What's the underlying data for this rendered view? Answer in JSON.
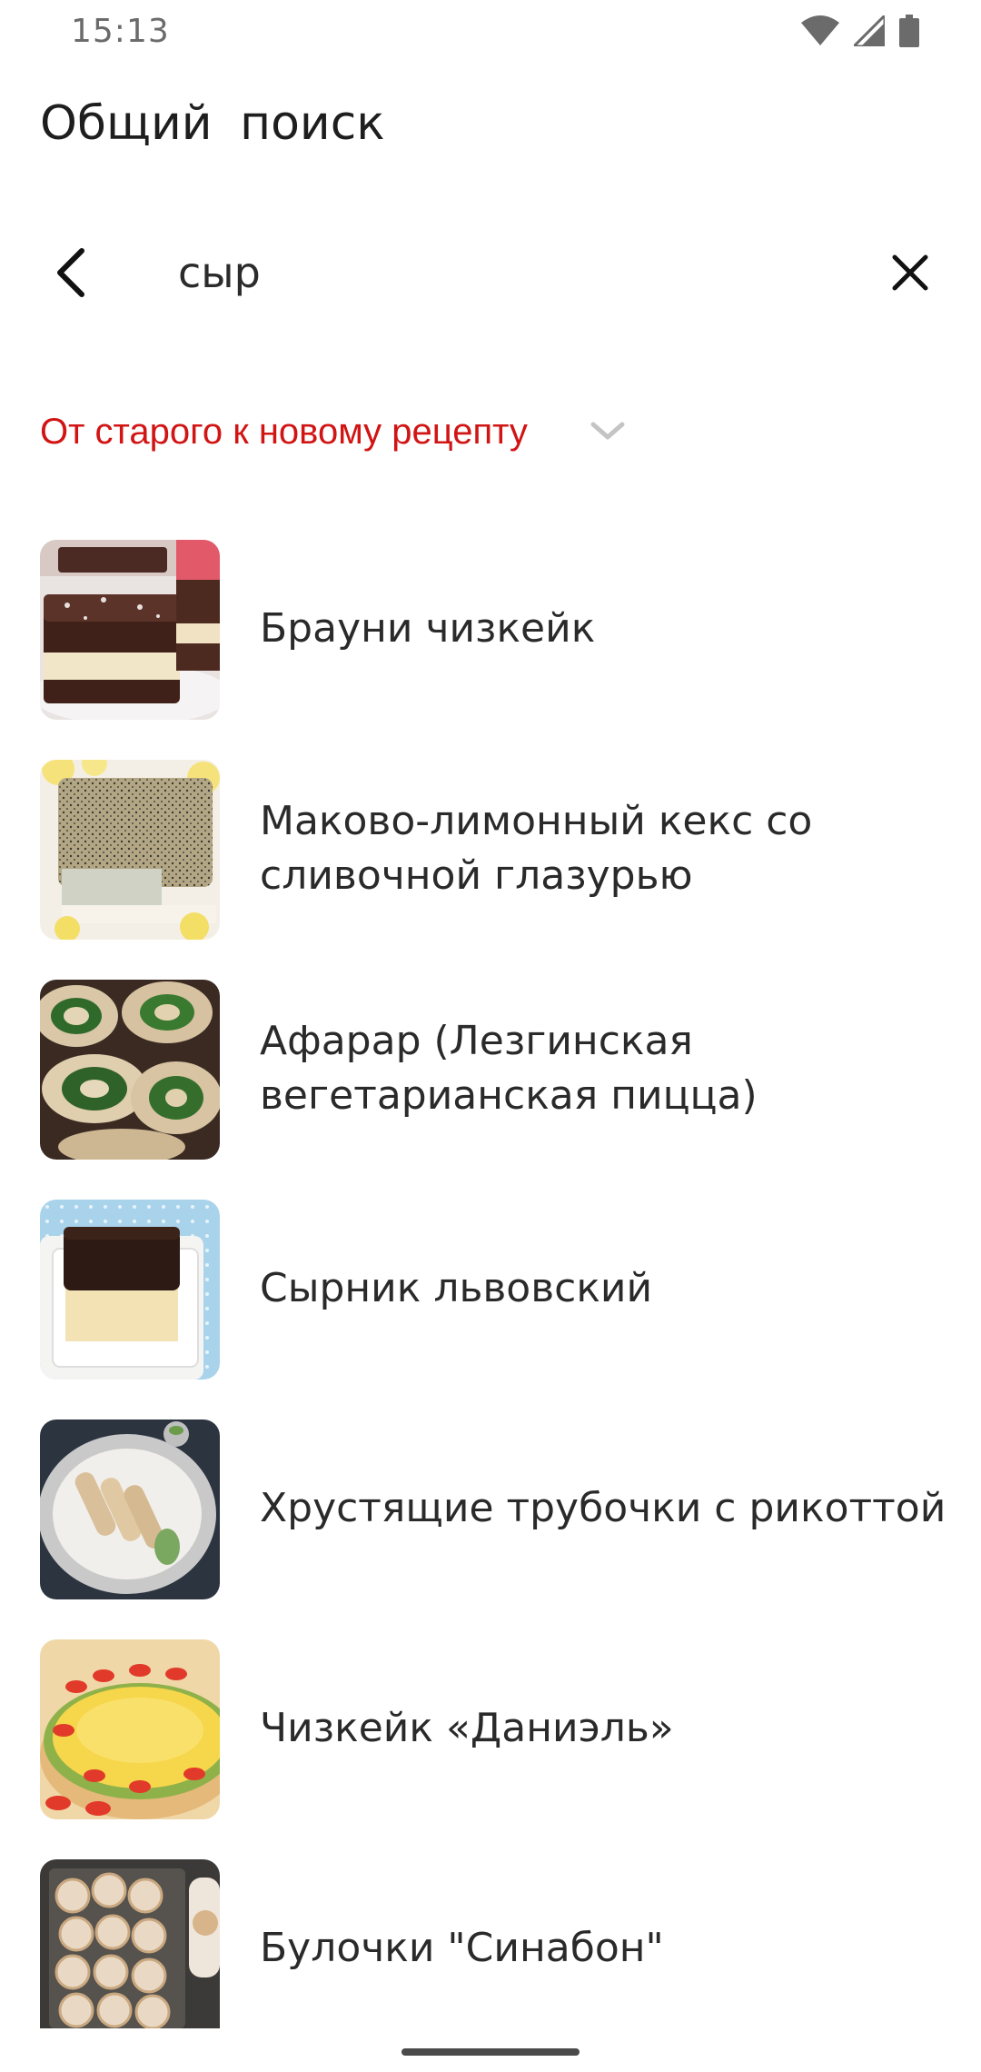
{
  "status_bar": {
    "time": "15:13",
    "icons": [
      "wifi-icon",
      "signal-icon",
      "battery-icon"
    ]
  },
  "header": {
    "title": "Общий  поиск"
  },
  "search": {
    "value": "сыр",
    "back_icon": "back-arrow-icon",
    "clear_icon": "close-icon"
  },
  "sort": {
    "label": "От старого к новому рецепту",
    "chevron_icon": "chevron-down-icon",
    "color": "#d11414"
  },
  "recipes": [
    {
      "title": "Брауни чизкейк",
      "thumb": "brownie-cheesecake-image"
    },
    {
      "title": "Маково-лимонный кекс со сливочной глазурью",
      "thumb": "poppy-lemon-cake-image"
    },
    {
      "title": "Афарар (Лезгинская вегетарианская пицца)",
      "thumb": "afarar-rolls-image"
    },
    {
      "title": "Сырник львовский",
      "thumb": "lviv-cheesecake-image"
    },
    {
      "title": "Хрустящие трубочки с рикоттой",
      "thumb": "ricotta-rolls-image"
    },
    {
      "title": "Чизкейк «Даниэль»",
      "thumb": "daniel-cheesecake-image"
    },
    {
      "title": "Булочки \"Синабон\"",
      "thumb": "cinnabon-buns-image"
    }
  ]
}
